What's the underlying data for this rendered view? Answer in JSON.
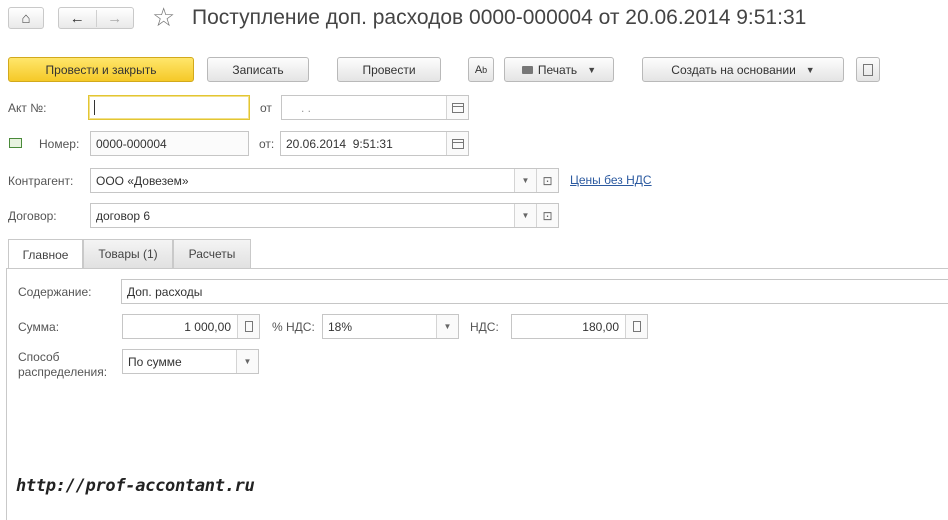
{
  "nav": {
    "home_glyph": "⌂",
    "back_glyph": "←",
    "forward_glyph": "→",
    "star_glyph": "☆"
  },
  "window": {
    "title": "Поступление доп. расходов 0000-000004 от 20.06.2014 9:51:31"
  },
  "toolbar": {
    "post_close": "Провести и закрыть",
    "save": "Записать",
    "post": "Провести",
    "print": "Печать",
    "create_based": "Создать на основании"
  },
  "header": {
    "act_label": "Акт №:",
    "act_value": "",
    "act_date_label": "от",
    "act_date_value": ". .",
    "number_label": "Номер:",
    "number_value": "0000-000004",
    "number_date_label": "от:",
    "number_date_value": "20.06.2014  9:51:31",
    "counterparty_label": "Контрагент:",
    "counterparty_value": "ООО «Довезем»",
    "prices_link": "Цены без НДС",
    "contract_label": "Договор:",
    "contract_value": "договор 6"
  },
  "tabs": [
    {
      "label": "Главное"
    },
    {
      "label": "Товары (1)"
    },
    {
      "label": "Расчеты"
    }
  ],
  "main": {
    "content_label": "Содержание:",
    "content_value": "Доп. расходы",
    "sum_label": "Сумма:",
    "sum_value": "1 000,00",
    "vat_rate_label": "% НДС:",
    "vat_rate_value": "18%",
    "vat_label": "НДС:",
    "vat_value": "180,00",
    "distribution_label_1": "Способ",
    "distribution_label_2": "распределения:",
    "distribution_value": "По сумме"
  },
  "watermark": "http://prof-accontant.ru",
  "colors": {
    "primary_button": "#f5c928",
    "link": "#2c5aa0",
    "focus_border": "#e3c633"
  }
}
